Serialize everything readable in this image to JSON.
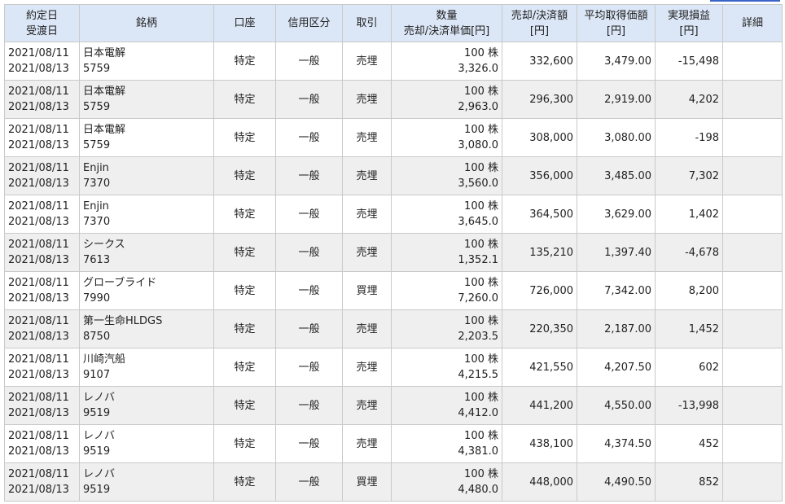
{
  "header": {
    "date_trade": "約定日",
    "date_settle": "受渡日",
    "name": "銘柄",
    "account": "口座",
    "credit": "信用区分",
    "trade": "取引",
    "qty_top": "数量",
    "qty_bottom": "売却/決済単価[円]",
    "amount_top": "売却/決済額",
    "amount_bottom": "[円]",
    "avg_top": "平均取得価額",
    "avg_bottom": "[円]",
    "pnl_top": "実現損益",
    "pnl_bottom": "[円]",
    "detail": "詳細"
  },
  "rows": [
    {
      "trade_date": "2021/08/11",
      "settle_date": "2021/08/13",
      "name": "日本電解",
      "code": "5759",
      "account": "特定",
      "credit": "一般",
      "trade": "売埋",
      "qty": "100 株",
      "price": "3,326.0",
      "amount": "332,600",
      "avg": "3,479.00",
      "pnl": "-15,498"
    },
    {
      "trade_date": "2021/08/11",
      "settle_date": "2021/08/13",
      "name": "日本電解",
      "code": "5759",
      "account": "特定",
      "credit": "一般",
      "trade": "売埋",
      "qty": "100 株",
      "price": "2,963.0",
      "amount": "296,300",
      "avg": "2,919.00",
      "pnl": "4,202"
    },
    {
      "trade_date": "2021/08/11",
      "settle_date": "2021/08/13",
      "name": "日本電解",
      "code": "5759",
      "account": "特定",
      "credit": "一般",
      "trade": "売埋",
      "qty": "100 株",
      "price": "3,080.0",
      "amount": "308,000",
      "avg": "3,080.00",
      "pnl": "-198"
    },
    {
      "trade_date": "2021/08/11",
      "settle_date": "2021/08/13",
      "name": "Enjin",
      "code": "7370",
      "account": "特定",
      "credit": "一般",
      "trade": "売埋",
      "qty": "100 株",
      "price": "3,560.0",
      "amount": "356,000",
      "avg": "3,485.00",
      "pnl": "7,302"
    },
    {
      "trade_date": "2021/08/11",
      "settle_date": "2021/08/13",
      "name": "Enjin",
      "code": "7370",
      "account": "特定",
      "credit": "一般",
      "trade": "売埋",
      "qty": "100 株",
      "price": "3,645.0",
      "amount": "364,500",
      "avg": "3,629.00",
      "pnl": "1,402"
    },
    {
      "trade_date": "2021/08/11",
      "settle_date": "2021/08/13",
      "name": "シークス",
      "code": "7613",
      "account": "特定",
      "credit": "一般",
      "trade": "売埋",
      "qty": "100 株",
      "price": "1,352.1",
      "amount": "135,210",
      "avg": "1,397.40",
      "pnl": "-4,678"
    },
    {
      "trade_date": "2021/08/11",
      "settle_date": "2021/08/13",
      "name": "グローブライド",
      "code": "7990",
      "account": "特定",
      "credit": "一般",
      "trade": "買埋",
      "qty": "100 株",
      "price": "7,260.0",
      "amount": "726,000",
      "avg": "7,342.00",
      "pnl": "8,200"
    },
    {
      "trade_date": "2021/08/11",
      "settle_date": "2021/08/13",
      "name": "第一生命HLDGS",
      "code": "8750",
      "account": "特定",
      "credit": "一般",
      "trade": "売埋",
      "qty": "100 株",
      "price": "2,203.5",
      "amount": "220,350",
      "avg": "2,187.00",
      "pnl": "1,452"
    },
    {
      "trade_date": "2021/08/11",
      "settle_date": "2021/08/13",
      "name": "川崎汽船",
      "code": "9107",
      "account": "特定",
      "credit": "一般",
      "trade": "売埋",
      "qty": "100 株",
      "price": "4,215.5",
      "amount": "421,550",
      "avg": "4,207.50",
      "pnl": "602"
    },
    {
      "trade_date": "2021/08/11",
      "settle_date": "2021/08/13",
      "name": "レノバ",
      "code": "9519",
      "account": "特定",
      "credit": "一般",
      "trade": "売埋",
      "qty": "100 株",
      "price": "4,412.0",
      "amount": "441,200",
      "avg": "4,550.00",
      "pnl": "-13,998"
    },
    {
      "trade_date": "2021/08/11",
      "settle_date": "2021/08/13",
      "name": "レノバ",
      "code": "9519",
      "account": "特定",
      "credit": "一般",
      "trade": "売埋",
      "qty": "100 株",
      "price": "4,381.0",
      "amount": "438,100",
      "avg": "4,374.50",
      "pnl": "452"
    },
    {
      "trade_date": "2021/08/11",
      "settle_date": "2021/08/13",
      "name": "レノバ",
      "code": "9519",
      "account": "特定",
      "credit": "一般",
      "trade": "買埋",
      "qty": "100 株",
      "price": "4,480.0",
      "amount": "448,000",
      "avg": "4,490.50",
      "pnl": "852"
    }
  ]
}
